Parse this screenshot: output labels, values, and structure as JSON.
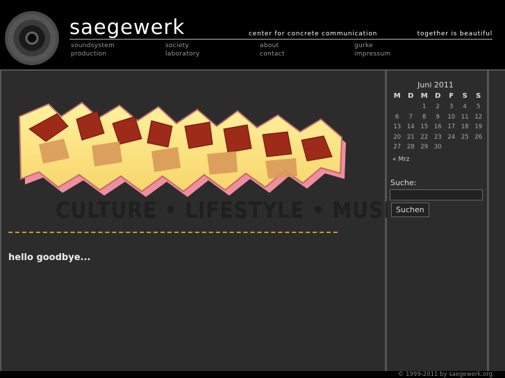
{
  "header": {
    "site_title": "saegewerk",
    "tagline_left": "center for concrete communication",
    "tagline_right": "together is beautiful",
    "nav": [
      {
        "label": "soundsystem"
      },
      {
        "label": "production"
      },
      {
        "label": "society"
      },
      {
        "label": "laboratory"
      },
      {
        "label": "about"
      },
      {
        "label": "contact"
      },
      {
        "label": "gurke"
      },
      {
        "label": "impressum"
      }
    ]
  },
  "main": {
    "banner_text": "saegewerk",
    "banner_subtext": "CULTURE • LIFESTYLE • MUSIC",
    "post_title": "hello goodbye..."
  },
  "sidebar": {
    "calendar": {
      "caption": "Juni 2011",
      "weekdays": [
        "M",
        "D",
        "M",
        "D",
        "F",
        "S",
        "S"
      ],
      "weeks": [
        [
          "",
          "",
          "1",
          "2",
          "3",
          "4",
          "5"
        ],
        [
          "6",
          "7",
          "8",
          "9",
          "10",
          "11",
          "12"
        ],
        [
          "13",
          "14",
          "15",
          "16",
          "17",
          "18",
          "19"
        ],
        [
          "20",
          "21",
          "22",
          "23",
          "24",
          "25",
          "26"
        ],
        [
          "27",
          "28",
          "29",
          "30",
          "",
          "",
          ""
        ]
      ],
      "prev_link": "« Mrz"
    },
    "search": {
      "label": "Suche:",
      "value": "",
      "button": "Suchen"
    }
  },
  "footer": {
    "text": "© 1999-2011 by saegewerk.org"
  }
}
